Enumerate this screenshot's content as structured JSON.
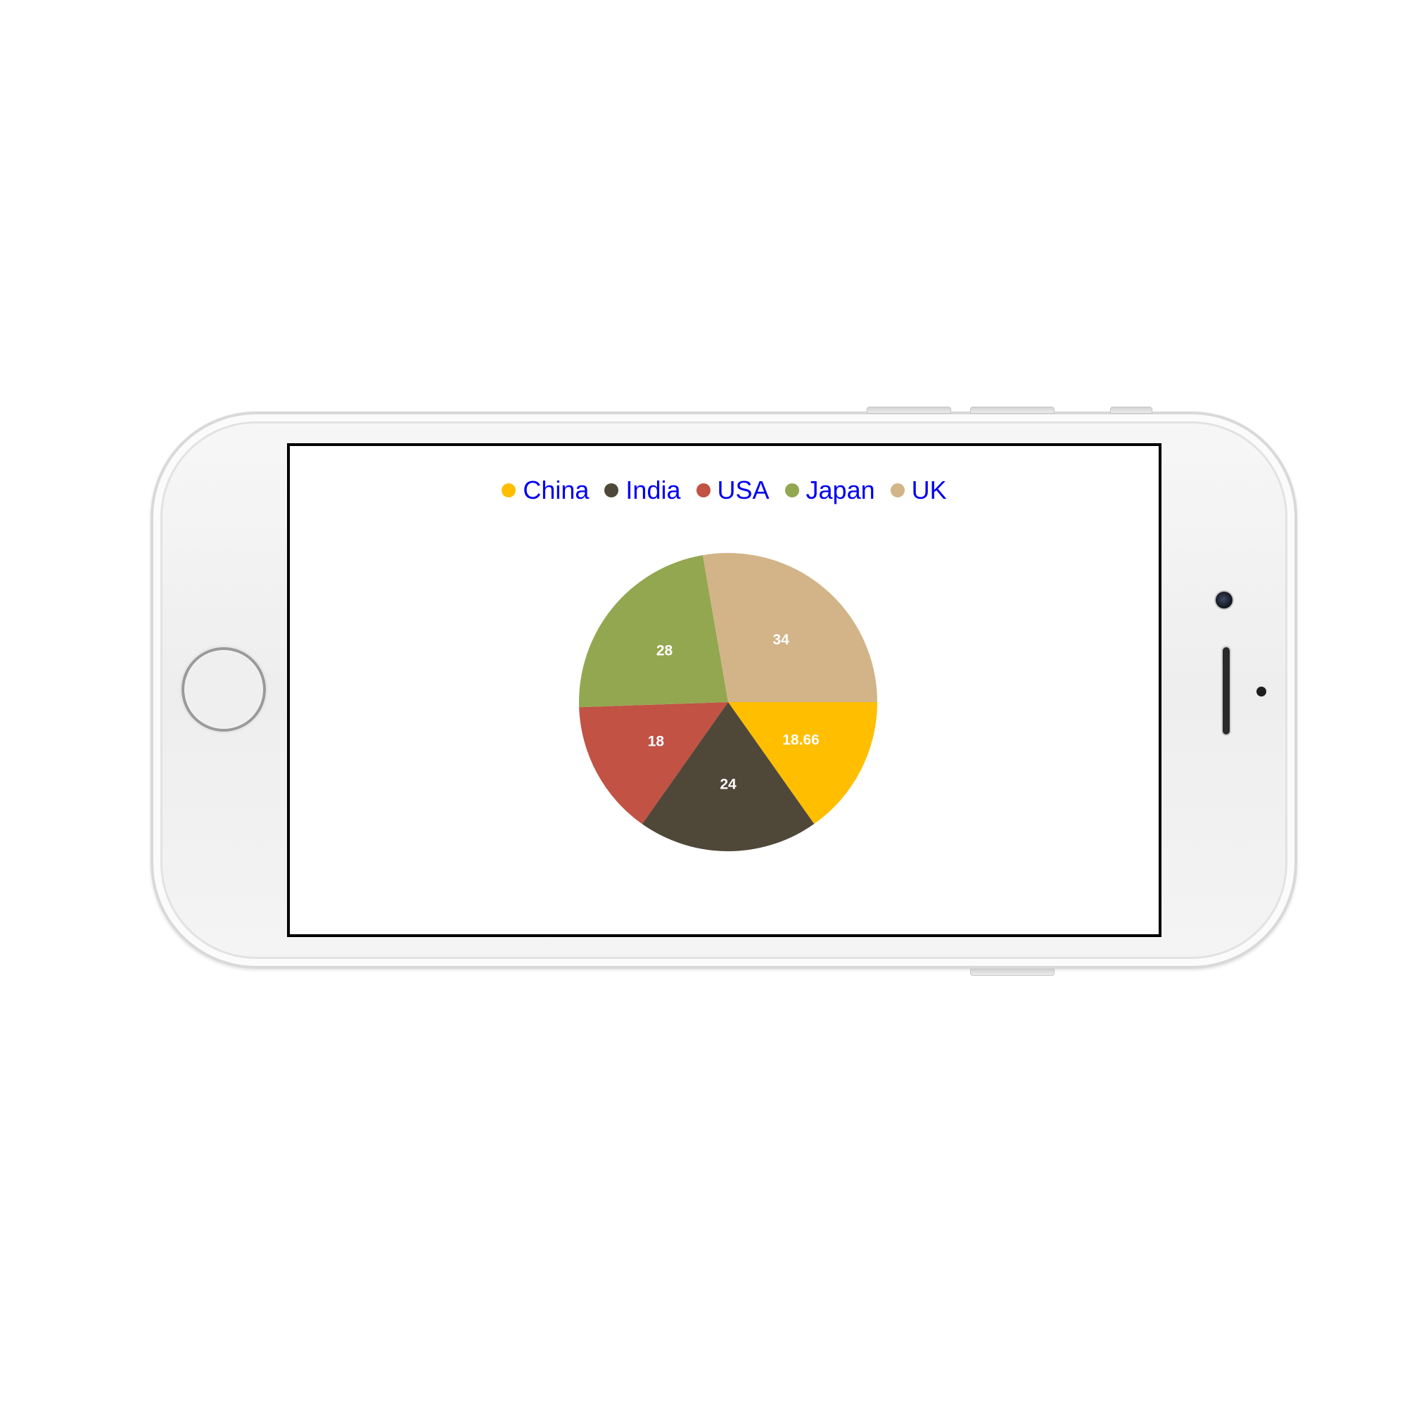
{
  "device": {
    "type": "phone-landscape",
    "icons": [
      "home-button-icon",
      "front-camera-icon",
      "earpiece-speaker-icon",
      "proximity-sensor-icon"
    ]
  },
  "chart_data": {
    "type": "pie",
    "categories": [
      "China",
      "India",
      "USA",
      "Japan",
      "UK"
    ],
    "values": [
      18.66,
      24,
      18,
      28,
      34
    ],
    "colors": [
      "#FFBE00",
      "#4F4839",
      "#C15244",
      "#93A750",
      "#D2B488"
    ],
    "data_labels": [
      "18.66",
      "24",
      "18",
      "28",
      "34"
    ],
    "data_label_color": "#FFFFFF",
    "start_angle_deg": 0,
    "direction": "clockwise",
    "legend": {
      "position": "top",
      "text_color": "#0000F0",
      "items": [
        {
          "label": "China",
          "color": "#FFBE00"
        },
        {
          "label": "India",
          "color": "#4F4839"
        },
        {
          "label": "USA",
          "color": "#C15244"
        },
        {
          "label": "Japan",
          "color": "#93A750"
        },
        {
          "label": "UK",
          "color": "#D2B488"
        }
      ]
    }
  }
}
